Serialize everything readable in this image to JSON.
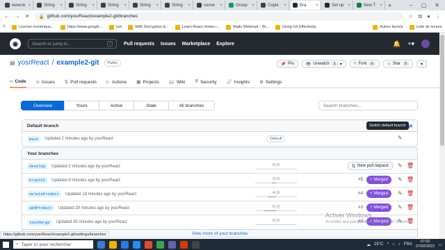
{
  "browser": {
    "tabs": [
      {
        "label": "www.te",
        "color": "#3c4043"
      },
      {
        "label": "String",
        "color": "#3c4043"
      },
      {
        "label": "String",
        "color": "#3c4043"
      },
      {
        "label": "String",
        "color": "#3c4043"
      },
      {
        "label": "String",
        "color": "#3c4043"
      },
      {
        "label": "String",
        "color": "#3c4043"
      },
      {
        "label": "conve",
        "color": "#3c4043"
      },
      {
        "label": "Group",
        "color": "#0f9d58"
      },
      {
        "label": "Copie",
        "color": "#3c4043"
      },
      {
        "label": "Bra",
        "color": "#24292f"
      },
      {
        "label": "Set up",
        "color": "#24292f"
      },
      {
        "label": "New T",
        "color": "#0b8043"
      }
    ],
    "url": "github.com/yosrReact/example2-git/branches",
    "bookmarks": [
      "Lisezse numérique...",
      "https://www.google...",
      "ovh",
      "Md5 Decryption &...",
      "Learn React Hooks i...",
      "Mailu Webmail :: Bi...",
      "Using Git Effectively"
    ],
    "bookmarks_right": [
      "Autres favoris",
      "Liste de lecture"
    ]
  },
  "github": {
    "search_placeholder": "Search or jump to...",
    "slash_key": "/",
    "nav": [
      "Pull requests",
      "Issues",
      "Marketplace",
      "Explore"
    ],
    "owner": "yosrReact",
    "separator": "/",
    "repo": "example2-git",
    "visibility": "Public",
    "pin": "Pin",
    "unwatch": "Unwatch",
    "unwatch_count": "1",
    "fork": "Fork",
    "fork_count": "0",
    "star": "Star",
    "star_count": "0",
    "tabs": [
      "Code",
      "Issues",
      "Pull requests",
      "Actions",
      "Projects",
      "Wiki",
      "Security",
      "Insights",
      "Settings"
    ]
  },
  "branches_page": {
    "filters": [
      "Overview",
      "Yours",
      "Active",
      "Stale",
      "All branches"
    ],
    "search_placeholder": "Search branches...",
    "default_section": "Default branch",
    "tooltip": "Switch default branch",
    "default_branch": {
      "name": "main",
      "updated": "Updated 2 minutes ago by yosrReact",
      "badge": "Default"
    },
    "yours_section": "Your branches",
    "branches": [
      {
        "name": "develop",
        "updated": "Updated 2 minutes ago by yosrReact",
        "behind": "0",
        "ahead": "0",
        "pr": "",
        "status": "",
        "action": "New pull request"
      },
      {
        "name": "branch2",
        "updated": "Updated 8 minutes ago by yosrReact",
        "behind": "2",
        "ahead": "0",
        "pr": "#5",
        "status": "Merged",
        "action": ""
      },
      {
        "name": "deleteProduct",
        "updated": "Updated 18 minutes ago by yosrReact",
        "behind": "4",
        "ahead": "0",
        "pr": "#4",
        "status": "Merged",
        "action": ""
      },
      {
        "name": "addProduct",
        "updated": "Updated 20 minutes ago by yosrReact",
        "behind": "6",
        "ahead": "0",
        "pr": "#3",
        "status": "Merged",
        "action": ""
      },
      {
        "name": "testMerge",
        "updated": "Updated 30 minutes ago by yosrReact",
        "behind": "0",
        "ahead": "0",
        "pr": "#2",
        "status": "Merged",
        "action": ""
      }
    ],
    "view_more": "View more of your branches"
  },
  "status_url": "https://github.com/yosrReact/example2-git/settings/branches",
  "watermark": {
    "title": "Activer Windows",
    "subtitle": "Accédez aux paramètres pour activer Windows."
  },
  "taskbar": {
    "search": "Taper ici pour rechercher",
    "temp": "15°C",
    "lang": "FRA",
    "time": "07:02",
    "date": "07/02/2022"
  },
  "colors": {
    "accent": "#0969da",
    "merged": "#8250df",
    "danger": "#cf222e",
    "header": "#24292f"
  }
}
